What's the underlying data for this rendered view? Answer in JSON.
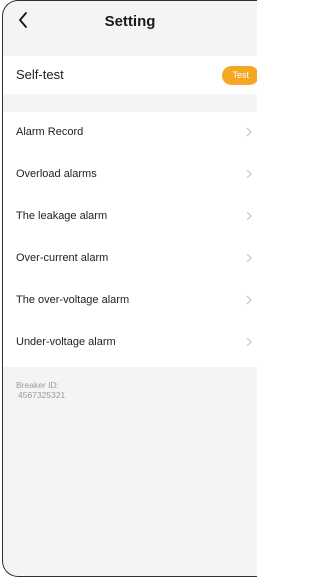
{
  "header": {
    "title": "Setting",
    "back_icon": "chevron-left-icon"
  },
  "selftest": {
    "label": "Self-test",
    "button_label": "Test",
    "button_color": "#f5a623"
  },
  "alarm_list": {
    "items": [
      {
        "label": "Alarm Record"
      },
      {
        "label": "Overload alarms"
      },
      {
        "label": "The leakage alarm"
      },
      {
        "label": "Over-current alarm"
      },
      {
        "label": "The over-voltage alarm"
      },
      {
        "label": "Under-voltage alarm"
      }
    ],
    "chevron_icon": "chevron-right-icon"
  },
  "breaker": {
    "label": "Breaker ID:",
    "id": "4567325321"
  },
  "colors": {
    "background": "#f4f4f4",
    "card": "#ffffff",
    "accent": "#f5a623",
    "muted_text": "#9a9a9a"
  }
}
